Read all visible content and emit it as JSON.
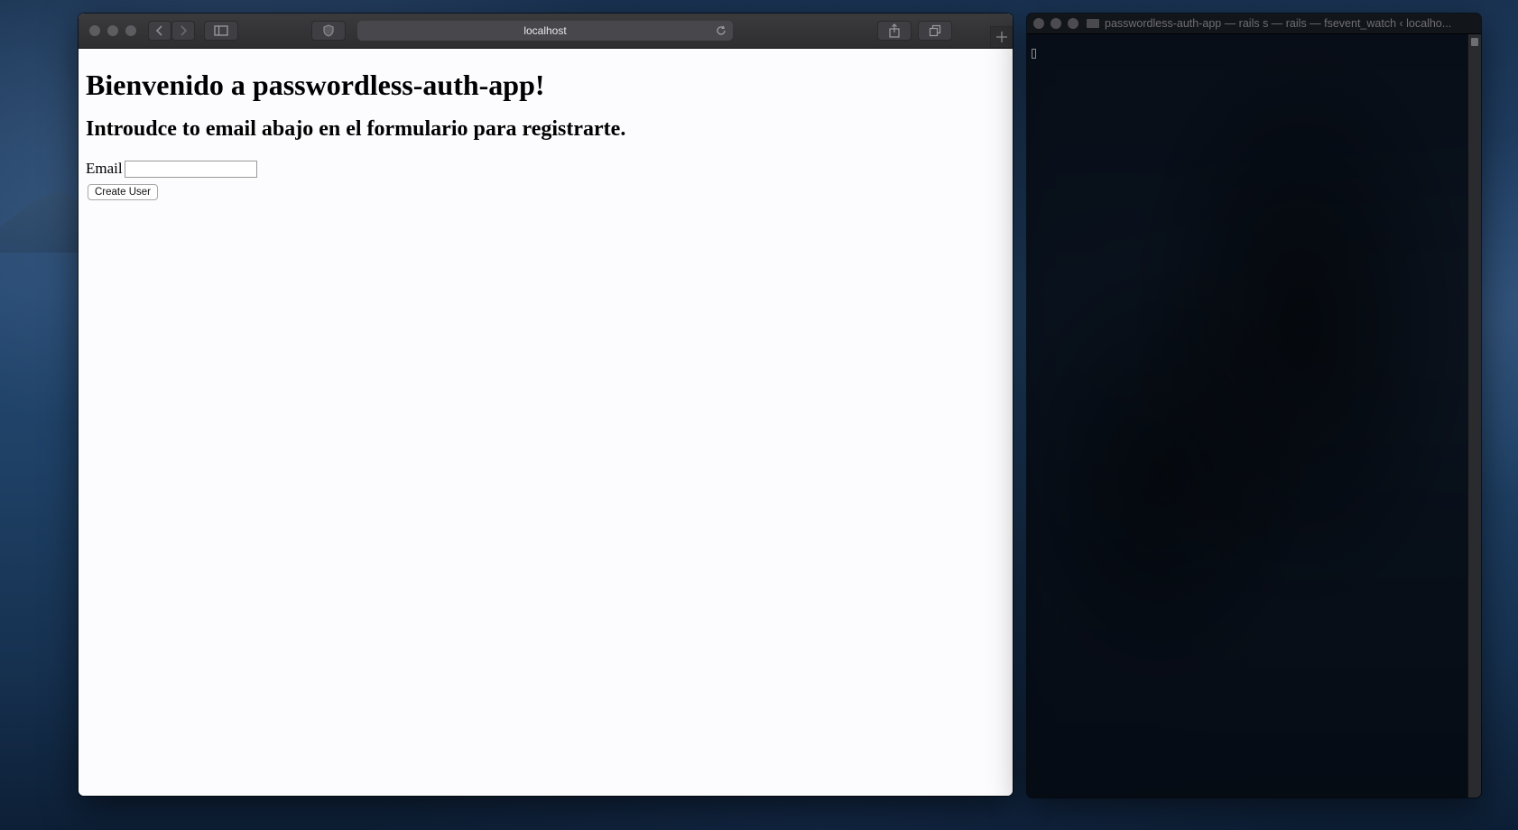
{
  "browser": {
    "address": "localhost",
    "page": {
      "heading": "Bienvenido a passwordless-auth-app!",
      "subheading": "Introudce to email abajo en el formulario para registrarte.",
      "form": {
        "email_label": "Email",
        "email_value": "",
        "submit_label": "Create User"
      }
    },
    "toolbar_icons": [
      "back-icon",
      "forward-icon",
      "sidebar-icon",
      "shield-icon",
      "reload-icon",
      "share-icon",
      "tabs-icon",
      "new-tab-icon"
    ]
  },
  "terminal": {
    "title": "passwordless-auth-app — rails s — rails — fsevent_watch ‹ localho..."
  },
  "colors": {
    "desktop": "#23466f",
    "toolbar": "#2e2e31",
    "page_background": "#fcfcfe",
    "terminal_background": "#05080e"
  }
}
